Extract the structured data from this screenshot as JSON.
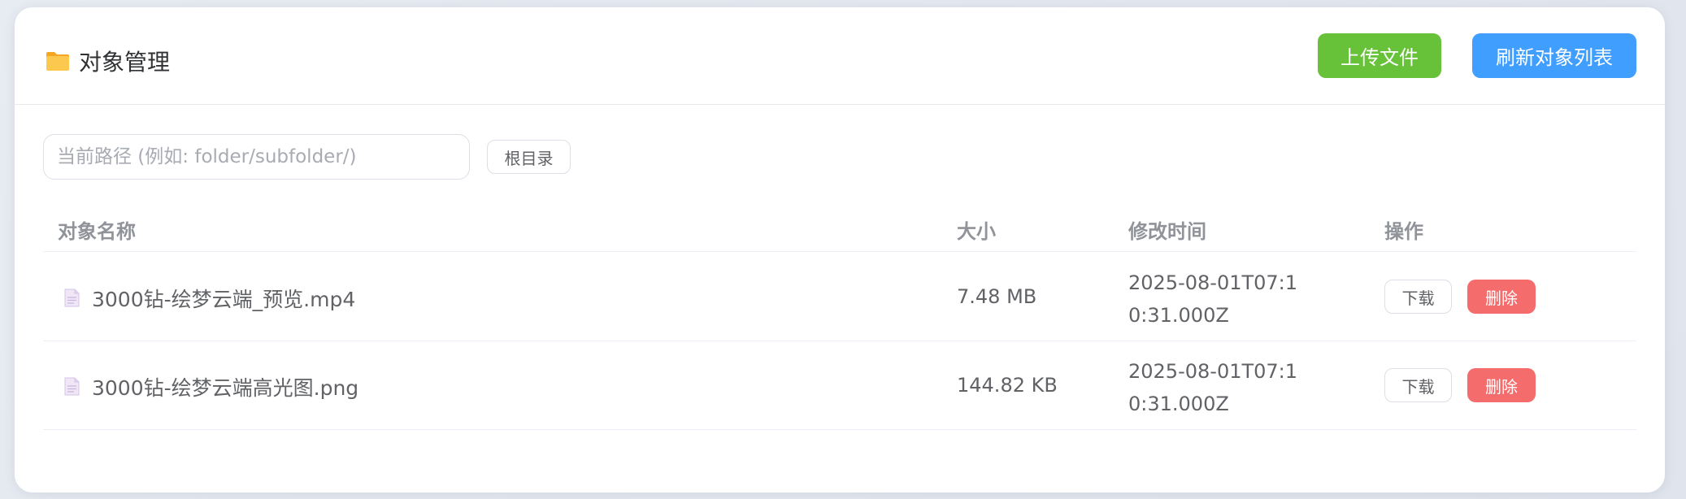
{
  "header": {
    "icon": "folder-icon",
    "title": "对象管理",
    "upload_label": "上传文件",
    "refresh_label": "刷新对象列表"
  },
  "path": {
    "value": "",
    "placeholder": "当前路径 (例如: folder/subfolder/)",
    "root_label": "根目录"
  },
  "table": {
    "columns": [
      "对象名称",
      "大小",
      "修改时间",
      "操作"
    ],
    "rows": [
      {
        "icon": "file-icon",
        "name": "3000钻-绘梦云端_预览.mp4",
        "size": "7.48 MB",
        "modified": "2025-08-01T07:10:31.000Z",
        "download_label": "下载",
        "delete_label": "删除"
      },
      {
        "icon": "file-icon",
        "name": "3000钻-绘梦云端高光图.png",
        "size": "144.82 KB",
        "modified": "2025-08-01T07:10:31.000Z",
        "download_label": "下载",
        "delete_label": "删除"
      }
    ]
  },
  "colors": {
    "upload": "#67c23a",
    "refresh": "#409eff",
    "delete": "#f56c6c",
    "folder": "#f7c04a"
  }
}
